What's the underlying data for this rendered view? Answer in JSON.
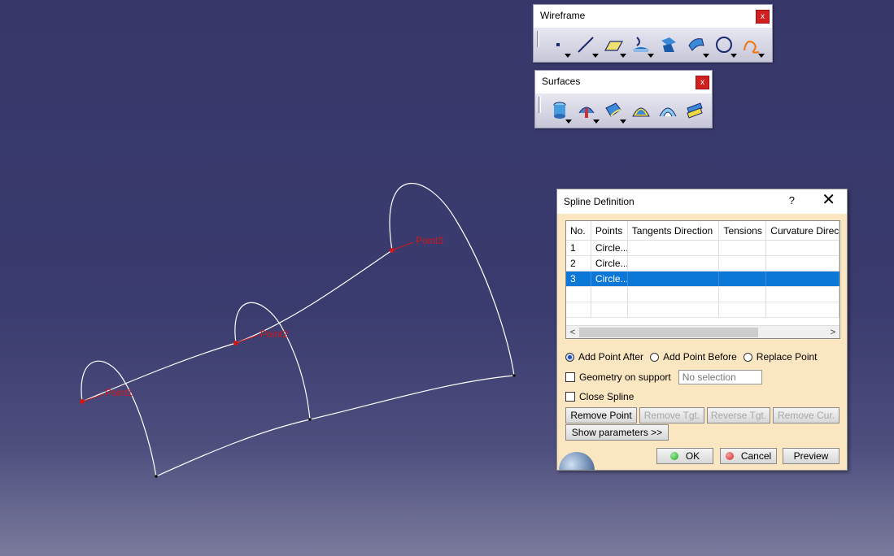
{
  "viewport": {
    "background_top": "#37376a",
    "background_bottom": "#7a7a9c",
    "curve_color": "#ffffff",
    "point_color": "#d01818",
    "points": [
      {
        "label": "Point1"
      },
      {
        "label": "Point2"
      },
      {
        "label": "Point3"
      }
    ]
  },
  "wireframe_toolbar": {
    "title": "Wireframe",
    "close": "x",
    "icons": [
      "point-icon",
      "line-icon",
      "plane-icon",
      "projection-icon",
      "intersection-icon",
      "offset-icon",
      "circle-icon",
      "spline-icon"
    ]
  },
  "surfaces_toolbar": {
    "title": "Surfaces",
    "close": "x",
    "icons": [
      "extrude-icon",
      "revolve-icon",
      "sweep-icon",
      "fill-icon",
      "loft-icon",
      "blend-icon"
    ]
  },
  "spline_dialog": {
    "title": "Spline Definition",
    "help": "?",
    "close": "✕",
    "table": {
      "columns": [
        "No.",
        "Points",
        "Tangents Direction",
        "Tensions",
        "Curvature Direc"
      ],
      "rows": [
        {
          "no": "1",
          "point": "Circle...",
          "tangent": "",
          "tension": "",
          "curvature": "",
          "selected": false
        },
        {
          "no": "2",
          "point": "Circle...",
          "tangent": "",
          "tension": "",
          "curvature": "",
          "selected": false
        },
        {
          "no": "3",
          "point": "Circle...",
          "tangent": "",
          "tension": "",
          "curvature": "",
          "selected": true
        }
      ],
      "scroll_left": "<",
      "scroll_right": ">"
    },
    "add_point_after": "Add Point After",
    "add_point_before": "Add Point Before",
    "replace_point": "Replace Point",
    "selected_mode": "Add Point After",
    "geometry_on_support": {
      "label": "Geometry on support",
      "checked": false,
      "value": "No selection"
    },
    "close_spline": {
      "label": "Close Spline",
      "checked": false
    },
    "buttons": {
      "remove_point": "Remove Point",
      "remove_tgt": "Remove Tgt.",
      "reverse_tgt": "Reverse Tgt.",
      "remove_cur": "Remove Cur.",
      "show_parameters": "Show parameters >>",
      "ok": "OK",
      "cancel": "Cancel",
      "preview": "Preview"
    },
    "colors": {
      "background": "#fbe6c2",
      "selection": "#0b78d7",
      "ok_dot": "#21a021",
      "cancel_dot": "#d02828"
    }
  }
}
